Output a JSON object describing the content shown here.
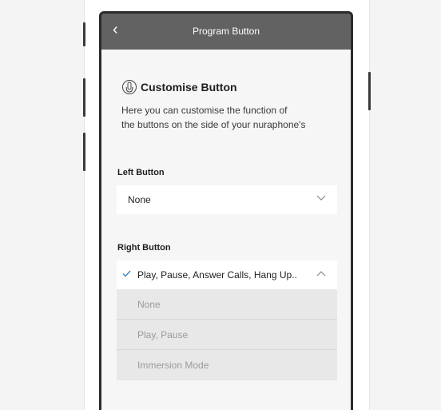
{
  "header": {
    "back_glyph": "‹",
    "title": "Program Button"
  },
  "section": {
    "icon": "button-hand-icon",
    "title": "Customise Button",
    "description_line1": "Here you can customise the function of",
    "description_line2": "the buttons on the side of your nuraphone's"
  },
  "left_button": {
    "label": "Left Button",
    "selected": "None",
    "chevron": "chevron-down-icon"
  },
  "right_button": {
    "label": "Right Button",
    "selected": "Play, Pause, Answer Calls, Hang Up..",
    "chevron": "chevron-up-icon",
    "options": [
      "None",
      "Play, Pause",
      "Immersion Mode"
    ]
  },
  "colors": {
    "topbar": "#626262",
    "check": "#3b82c4",
    "option_bg": "#e8e8e8",
    "option_text": "#9a9a9a"
  }
}
